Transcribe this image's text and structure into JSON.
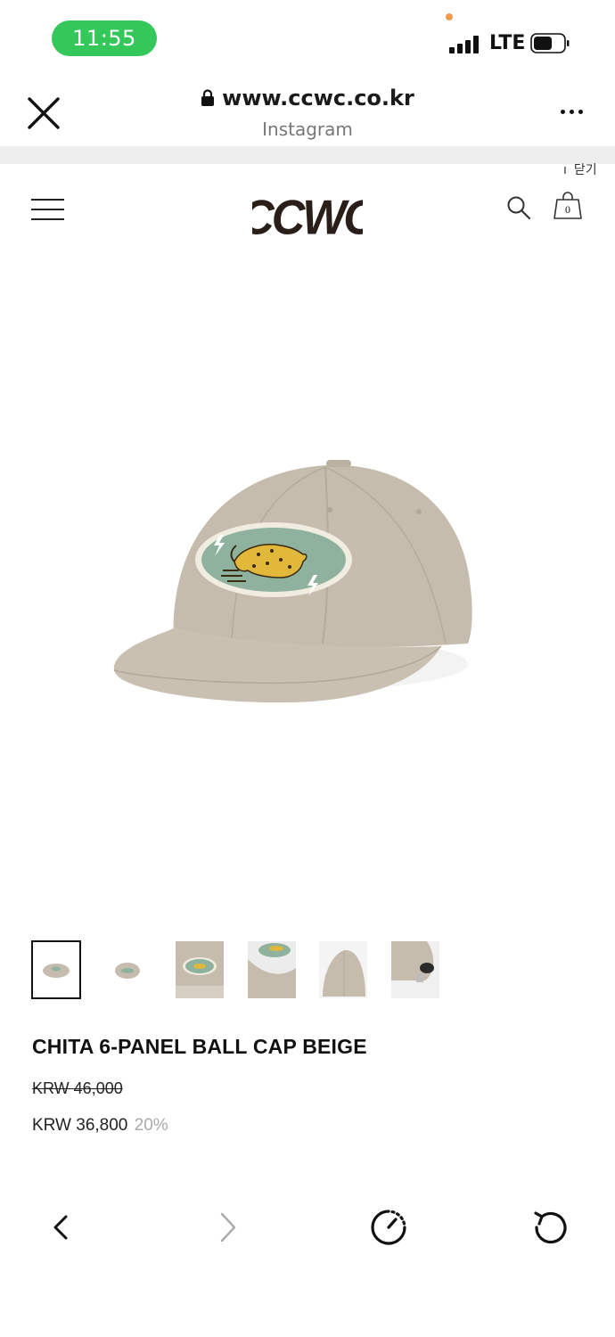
{
  "status_bar": {
    "time": "11:55",
    "network": "LTE"
  },
  "browser": {
    "url": "www.ccwc.co.kr",
    "source": "Instagram"
  },
  "site": {
    "close_link": "닫기",
    "logo": "CCWC",
    "cart_count": "0"
  },
  "product": {
    "name": "CHITA 6-PANEL BALL CAP BEIGE",
    "original_price": "KRW 46,000",
    "sale_price": "KRW 36,800",
    "discount": "20%",
    "thumbnail_count": 6,
    "selected_thumbnail": 1
  },
  "colors": {
    "status_green": "#34c759",
    "cap_beige": "#c5bcae",
    "patch_green": "#8fb29e",
    "cheetah_yellow": "#e2b83a"
  }
}
